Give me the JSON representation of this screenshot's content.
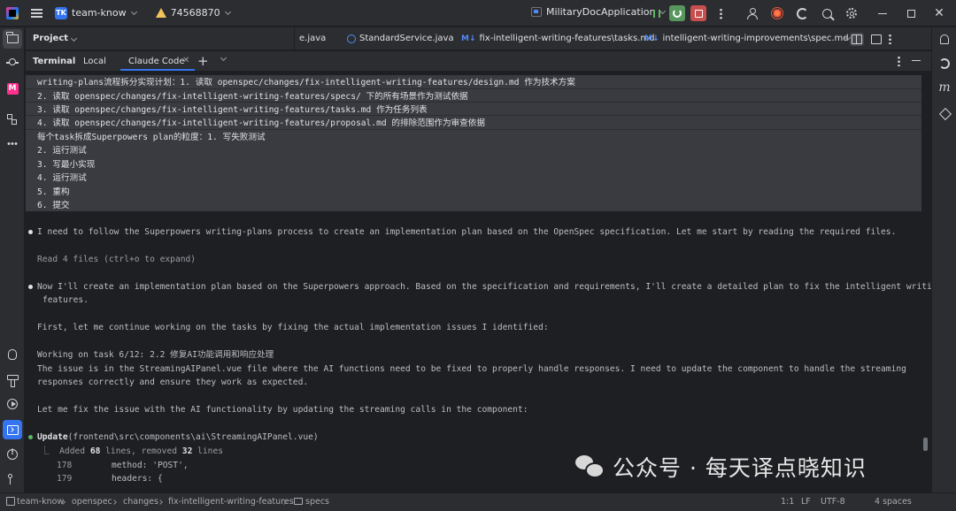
{
  "titlebar": {
    "project_badge": "TK",
    "project_name": "team-know",
    "branch": "74568870",
    "run_config": "MilitaryDocApplication"
  },
  "tabs_row": {
    "project_label": "Project",
    "tabs": [
      {
        "label": "e.java",
        "icon": "none"
      },
      {
        "label": "StandardService.java",
        "icon": "c-icon"
      },
      {
        "label": "fix-intelligent-writing-features\\tasks.md",
        "icon": "md-icon"
      },
      {
        "label": "intelligent-writing-improvements\\spec.md",
        "icon": "md-icon"
      }
    ],
    "md_prefix": "M↓"
  },
  "terminal_tabs": {
    "title": "Terminal",
    "tabs": [
      "Local",
      "Claude Code"
    ],
    "selected": "Claude Code"
  },
  "terminal": {
    "prompt_lines": [
      "writing-plans流程拆分实现计划：1. 读取 openspec/changes/fix-intelligent-writing-features/design.md 作为技术方案",
      "2. 读取 openspec/changes/fix-intelligent-writing-features/specs/ 下的所有场景作为测试依据",
      "3. 读取 openspec/changes/fix-intelligent-writing-features/tasks.md 作为任务列表",
      "4. 读取 openspec/changes/fix-intelligent-writing-features/proposal.md 的排除范围作为审查依据",
      "每个task拆成Superpowers plan的粒度：1. 写失败测试",
      "2. 运行测试",
      "3. 写最小实现",
      "4. 运行测试",
      "5. 重构",
      "6. 提交"
    ],
    "msg1": "I need to follow the Superpowers writing-plans process to create an implementation plan based on the OpenSpec specification. Let me start by reading the required files.",
    "read_files": "Read 4 files (ctrl+o to expand)",
    "msg2_line1": "Now I'll create an implementation plan based on the Superpowers approach. Based on the specification and requirements, I'll create a detailed plan to fix the intelligent writing",
    "msg2_line2": "features.",
    "msg3": "First, let me continue working on the tasks by fixing the actual implementation issues I identified:",
    "msg4_line1": "Working on task 6/12: 2.2 修复AI功能调用和响应处理",
    "msg4_line2": "The issue is in the StreamingAIPanel.vue file where the AI functions need to be fixed to properly handle responses. I need to update the component to handle the streaming",
    "msg4_line3": "responses correctly and ensure they work as expected.",
    "msg5": "Let me fix the issue with the AI functionality by updating the streaming calls in the component:",
    "update_label": "Update",
    "update_path": "(frontend\\src\\components\\ai\\StreamingAIPanel.vue)",
    "diff_summary_prefix": "⎿  Added ",
    "diff_added": "68",
    "diff_mid": " lines, removed ",
    "diff_removed": "32",
    "diff_suffix": " lines",
    "code_lines": [
      {
        "num": "178",
        "code": "method: 'POST',"
      },
      {
        "num": "179",
        "code": "headers: {"
      }
    ]
  },
  "watermark": "公众号 · 每天译点晓知识",
  "statusbar": {
    "breadcrumb": [
      "team-know",
      "openspec",
      "changes",
      "fix-intelligent-writing-features",
      "specs"
    ],
    "position": "1:1",
    "line_sep": "LF",
    "encoding": "UTF-8",
    "indent": "4 spaces"
  },
  "colors": {
    "accent": "#3574f0",
    "warning": "#f2c55c",
    "success": "#5fb865",
    "stop": "#c94f4f"
  }
}
